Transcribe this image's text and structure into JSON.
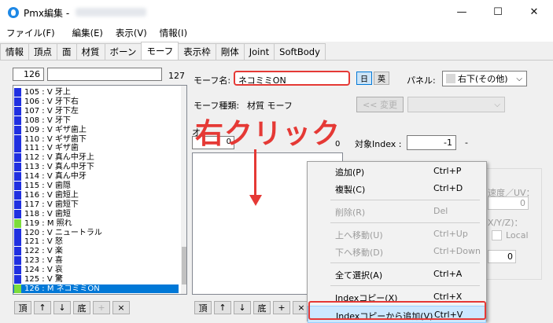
{
  "window": {
    "title": "Pmx編集 -",
    "minimize": "—",
    "maximize": "☐",
    "close": "✕"
  },
  "menu": [
    "ファイル(F)",
    "編集(E)",
    "表示(V)",
    "情報(I)"
  ],
  "tabs": [
    "情報",
    "頂点",
    "面",
    "材質",
    "ボーン",
    "モーフ",
    "表示枠",
    "剛体",
    "Joint",
    "SoftBody"
  ],
  "active_tab": "モーフ",
  "left": {
    "index_value": "126",
    "count": "127",
    "rows": [
      {
        "text": "105 : V  牙上",
        "color": "#2030e0"
      },
      {
        "text": "106 : V  牙下右",
        "color": "#2030e0"
      },
      {
        "text": "107 : V  牙下左",
        "color": "#2030e0"
      },
      {
        "text": "108 : V  牙下",
        "color": "#2030e0"
      },
      {
        "text": "109 : V  ギザ歯上",
        "color": "#2030e0"
      },
      {
        "text": "110 : V  ギザ歯下",
        "color": "#2030e0"
      },
      {
        "text": "111 : V  ギザ歯",
        "color": "#2030e0"
      },
      {
        "text": "112 : V  真ん中牙上",
        "color": "#2030e0"
      },
      {
        "text": "113 : V  真ん中牙下",
        "color": "#2030e0"
      },
      {
        "text": "114 : V  真ん中牙",
        "color": "#2030e0"
      },
      {
        "text": "115 : V  歯隠",
        "color": "#2030e0"
      },
      {
        "text": "116 : V  歯短上",
        "color": "#2030e0"
      },
      {
        "text": "117 : V  歯短下",
        "color": "#2030e0"
      },
      {
        "text": "118 : V  歯短",
        "color": "#2030e0"
      },
      {
        "text": "119 : M  照れ",
        "color": "#7ddc3c"
      },
      {
        "text": "120 : V  ニュートラル",
        "color": "#2030e0"
      },
      {
        "text": "121 : V  怒",
        "color": "#2030e0"
      },
      {
        "text": "122 : V  楽",
        "color": "#2030e0"
      },
      {
        "text": "123 : V  喜",
        "color": "#2030e0"
      },
      {
        "text": "124 : V  哀",
        "color": "#2030e0"
      },
      {
        "text": "125 : V  驚",
        "color": "#2030e0"
      },
      {
        "text": "126 : M  ネコミミON",
        "color": "#7ddc3c",
        "selected": true
      }
    ],
    "buttons": [
      "頂",
      "↑",
      "↓",
      "底",
      "+",
      "×"
    ]
  },
  "right": {
    "morph_name_label": "モーフ名:",
    "morph_name_value": "ネコミミON",
    "lang_jp": "日",
    "lang_en": "英",
    "panel_label": "パネル:",
    "panel_value": "右下(その他)",
    "morph_type_label": "モーフ種類:",
    "morph_type_value": "材質 モーフ",
    "change_button": "<< 変更",
    "offset_label_partial": "オ",
    "offset_count_value": "0",
    "offset_total": "0",
    "target_index_label": "対象Index :",
    "target_index_value": "-1",
    "dash": "-",
    "annotation": "右クリック",
    "speed_label": "速度／UV：",
    "speed_value": "0",
    "xyz_label": "X/Y/Z)：",
    "local_label": "Local",
    "bottom_value": "0",
    "bottom_buttons": [
      "頂",
      "↑",
      "↓",
      "底",
      "+",
      "×"
    ]
  },
  "context_menu": [
    {
      "label": "追加(P)",
      "shortcut": "Ctrl+P",
      "disabled": false
    },
    {
      "label": "複製(C)",
      "shortcut": "Ctrl+D",
      "disabled": false
    },
    {
      "sep": true
    },
    {
      "label": "削除(R)",
      "shortcut": "Del",
      "disabled": true
    },
    {
      "sep": true
    },
    {
      "label": "上へ移動(U)",
      "shortcut": "Ctrl+Up",
      "disabled": true
    },
    {
      "label": "下へ移動(D)",
      "shortcut": "Ctrl+Down",
      "disabled": true
    },
    {
      "sep": true
    },
    {
      "label": "全て選択(A)",
      "shortcut": "Ctrl+A",
      "disabled": false
    },
    {
      "sep": true
    },
    {
      "label": "Indexコピー(X)",
      "shortcut": "Ctrl+X",
      "disabled": false
    },
    {
      "label": "Indexコピーから追加(V)",
      "shortcut": "Ctrl+V",
      "disabled": false,
      "highlighted": true
    }
  ],
  "colors": {
    "accent": "#0078d7",
    "annotation": "#e53935",
    "morph_v": "#2030e0",
    "morph_m": "#7ddc3c"
  }
}
